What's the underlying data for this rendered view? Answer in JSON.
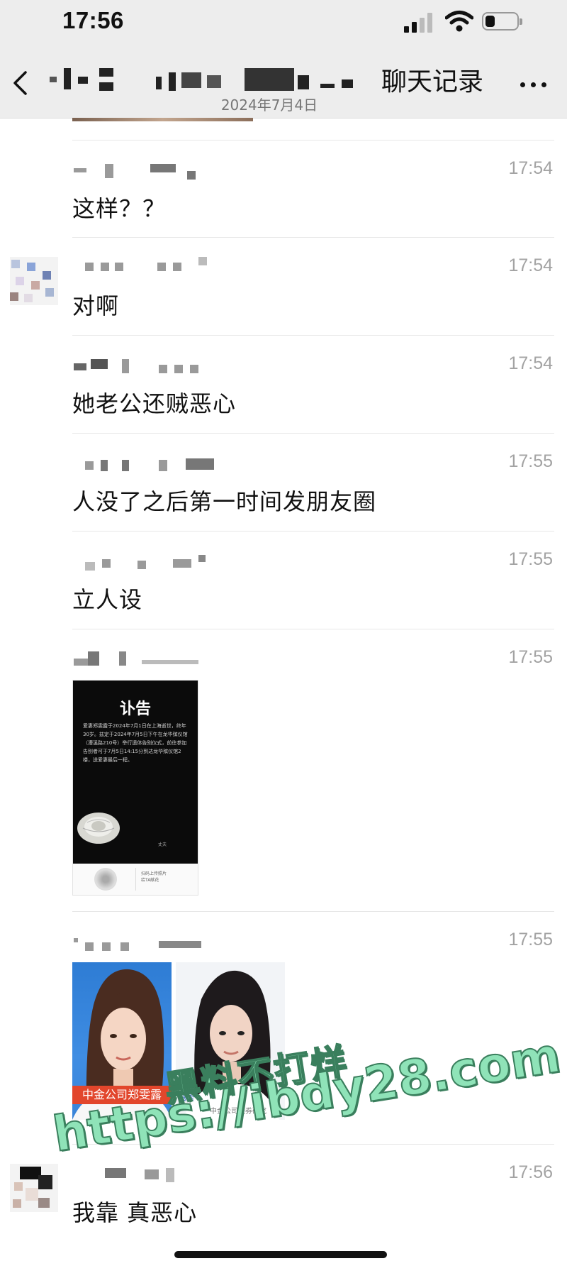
{
  "status_bar": {
    "time": "17:56",
    "signal_icon": "cellular-signal-icon",
    "wifi_icon": "wifi-icon",
    "battery_icon": "battery-icon",
    "battery_level": 0.3
  },
  "nav": {
    "back_icon": "chevron-left-icon",
    "title": "聊天记录",
    "date": "2024年7月4日",
    "more_icon": "more-icon"
  },
  "records": [
    {
      "time": "17:54",
      "text": "这样？？"
    },
    {
      "time": "17:54",
      "text": "对啊"
    },
    {
      "time": "17:54",
      "text": "她老公还贼恶心"
    },
    {
      "time": "17:55",
      "text": "人没了之后第一时间发朋友圈"
    },
    {
      "time": "17:55",
      "text": "立人设"
    },
    {
      "time": "17:55",
      "obituary": {
        "title": "讣告",
        "body": "爱妻郑雯露于2024年7月1日在上海逝世，终年30岁。兹定于2024年7月5日下午在龙华殡仪馆（漕溪路210号）举行遗体告别仪式，前往参加告别者可于7月5日14:15分到达龙华殡仪馆2楼，送爱妻最后一程。",
        "sign": "丈夫",
        "footer": "扫码上传照片\n给TA献花"
      }
    },
    {
      "time": "17:55",
      "photo_caption": "中金公司郑雯露",
      "photo_small_caption": "搜索",
      "photo_tiny_caption": "中金公司证券研究"
    },
    {
      "time": "17:56",
      "text": "我靠 真恶心"
    }
  ],
  "watermark": {
    "line1": "黑料不打烊",
    "line2": "https://ibdy28.com"
  },
  "colors": {
    "background": "#ffffff",
    "bar_background": "#ededed",
    "timestamp": "#a3a3a3",
    "caption_red": "#e2462c",
    "watermark_fill": "#8fe3b8"
  }
}
